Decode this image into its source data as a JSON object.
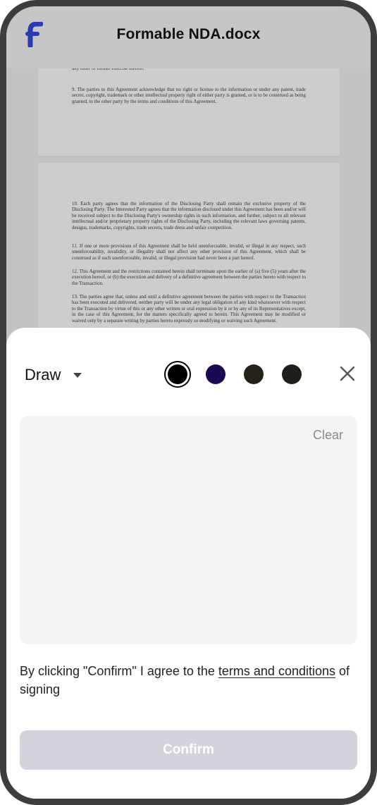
{
  "header": {
    "title": "Formable NDA.docx",
    "logo_icon": "formable-logo-icon"
  },
  "document": {
    "page1_paragraphs": [
      "shall operate as a waiver thereof, nor shall any single or partial exercise of any such right, power, or privilege preclude any other or further exercise thereof.",
      "9.        The parties to this Agreement acknowledge that no right or license to the information or under any patent, trade secret, copyright, trademark or other intellectual property right of either party is granted, or is to be construed as being granted, to the other party by the terms and conditions of this Agreement."
    ],
    "page2_paragraphs": [
      "10.       Each party agrees that the information of the Disclosing Party shall remain the exclusive property of the Disclosing Party. The Interested Party agrees that the information disclosed under this Agreement has been and/or will be received subject to the Disclosing Party's ownership rights in such information, and further, subject to all relevant intellectual and/or proprietary property rights of the Disclosing Party, including the relevant laws governing patents, designs, trademarks, copyrights, trade secrets, trade dress and unfair competition.",
      "11.       If one or more provisions of this Agreement shall be held unenforceable, invalid, or illegal in any respect, such unenforceability, invalidity, or illegality shall not affect any other provision of this Agreement, which shall be construed as if such unenforceable, invalid, or illegal provision had never been a part hereof.",
      "12.       This Agreement and the restrictions contained herein shall terminate upon the earlier of (a) five (5) years after the execution hereof, or (b) the execution and delivery of a definitive agreement between the parties hereto with respect to the Transaction.",
      "13.       The parties agree that, unless and until a definitive agreement between the parties with respect to the Transaction has been executed and delivered, neither party will be under any legal obligation of any kind whatsoever with respect to the Transaction by virtue of this or any other written or oral expression by it or by any of its Representatives except, in the case of this Agreement, for the matters specifically agreed to herein. This Agreement may be modified or waived only by a separate writing by parties hereto expressly so modifying or waiving such Agreement."
    ]
  },
  "signature_sheet": {
    "mode_label": "Draw",
    "mode_icon": "caret-down-icon",
    "colors": [
      {
        "name": "black",
        "hex": "#000000",
        "selected": true
      },
      {
        "name": "navy",
        "hex": "#1b0a52",
        "selected": false
      },
      {
        "name": "dark-olive",
        "hex": "#23211a",
        "selected": false
      },
      {
        "name": "dark-gray",
        "hex": "#1f1e1b",
        "selected": false
      }
    ],
    "close_icon": "close-icon",
    "clear_label": "Clear",
    "agree_prefix": "By clicking \"Confirm\" I agree to the ",
    "agree_link": "terms and conditions",
    "agree_suffix": " of signing",
    "confirm_label": "Confirm"
  },
  "theme": {
    "accent": "#2b3fbe",
    "confirm_disabled_bg": "#d2d3db"
  }
}
